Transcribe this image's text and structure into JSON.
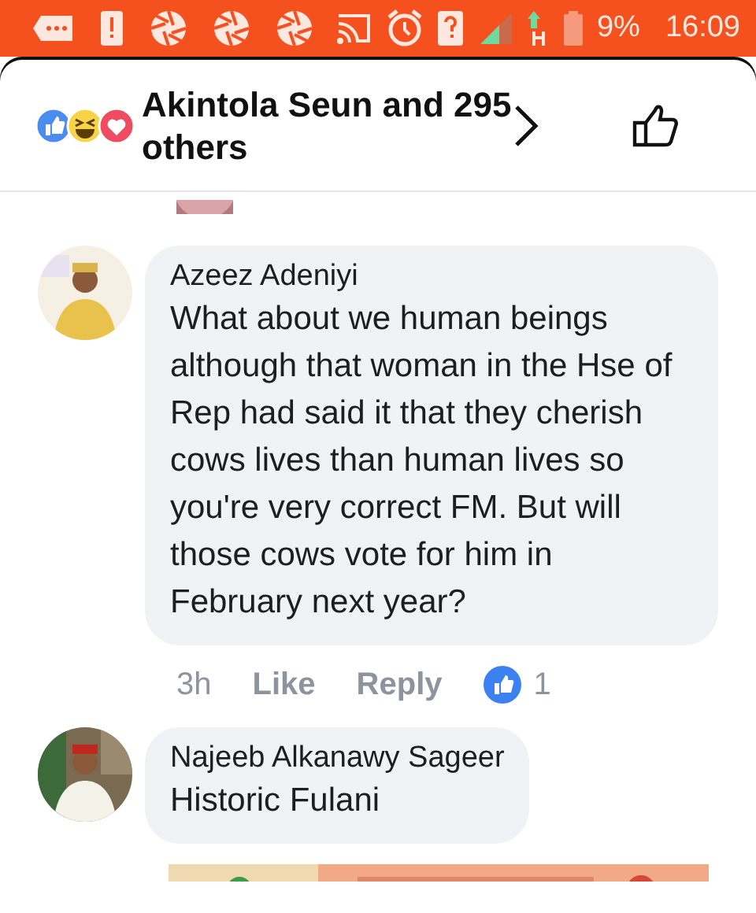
{
  "status_bar": {
    "battery": "9%",
    "time": "16:09"
  },
  "reactions": {
    "summary": "Akintola Seun and 295 others"
  },
  "comments": [
    {
      "author": "Azeez Adeniyi",
      "text": "What about we human beings although that woman in the Hse of Rep had said it that they cherish cows lives than human lives so you're very correct FM. But will those cows vote for him in February next year?",
      "time": "3h",
      "actions": [
        "Like",
        "Reply"
      ],
      "reaction_count": "1"
    },
    {
      "author": "Najeeb Alkanawy Sageer",
      "text": "Historic Fulani"
    }
  ]
}
